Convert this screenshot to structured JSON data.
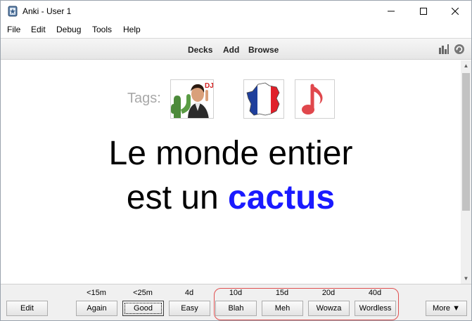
{
  "window": {
    "title": "Anki - User 1"
  },
  "menu": {
    "items": [
      "File",
      "Edit",
      "Debug",
      "Tools",
      "Help"
    ]
  },
  "toolbar": {
    "decks": "Decks",
    "add": "Add",
    "browse": "Browse"
  },
  "card": {
    "tags_label": "Tags:",
    "tag_images": [
      "cactus-man-photo",
      "france-flag-map",
      "music-note"
    ],
    "photo_caption": "DJU",
    "line1": "Le monde entier",
    "line2_prefix": "est un ",
    "line2_highlight": "cactus"
  },
  "bottom": {
    "edit": "Edit",
    "more": "More ▼",
    "answers": [
      {
        "time": "<15m",
        "label": "Again"
      },
      {
        "time": "<25m",
        "label": "Good"
      },
      {
        "time": "4d",
        "label": "Easy"
      },
      {
        "time": "10d",
        "label": "Blah"
      },
      {
        "time": "15d",
        "label": "Meh"
      },
      {
        "time": "20d",
        "label": "Wowza"
      },
      {
        "time": "40d",
        "label": "Wordless"
      }
    ]
  },
  "colors": {
    "highlight": "#1a1aff",
    "annotation": "#e05050",
    "tags_label": "#a8a8a8"
  }
}
